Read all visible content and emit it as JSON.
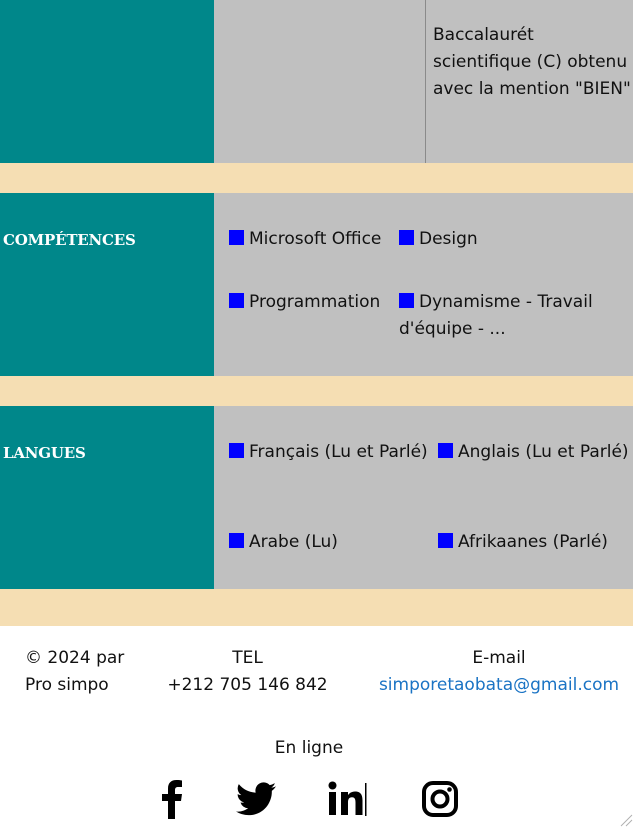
{
  "education": {
    "entry_text": "Baccalaurét scientifique (C) obtenu avec la mention \"BIEN\""
  },
  "competences": {
    "title": "COMPÉTENCES",
    "items": [
      "Microsoft Office",
      "Design",
      "Programmation",
      "Dynamisme - Travail d'équipe - ..."
    ]
  },
  "langues": {
    "title": "LANGUES",
    "items": [
      "Français (Lu et Parlé)",
      "Anglais (Lu et Parlé)",
      "Arabe (Lu)",
      "Afrikaanes (Parlé)"
    ]
  },
  "footer": {
    "copyright_line1": "© 2024 par",
    "copyright_line2": "Pro simpo",
    "tel_label": "TEL",
    "tel_value": "+212 705 146 842",
    "email_label": "E-mail",
    "email_value": "simporetaobata@gmail.com",
    "online_label": "En ligne",
    "social_icons": [
      "facebook-icon",
      "twitter-icon",
      "linkedin-icon",
      "instagram-icon"
    ]
  },
  "colors": {
    "teal": "#00878a",
    "grey": "#c0c0c0",
    "beige": "#f5deb3",
    "bullet": "#0000ff",
    "link": "#1a73c4"
  }
}
